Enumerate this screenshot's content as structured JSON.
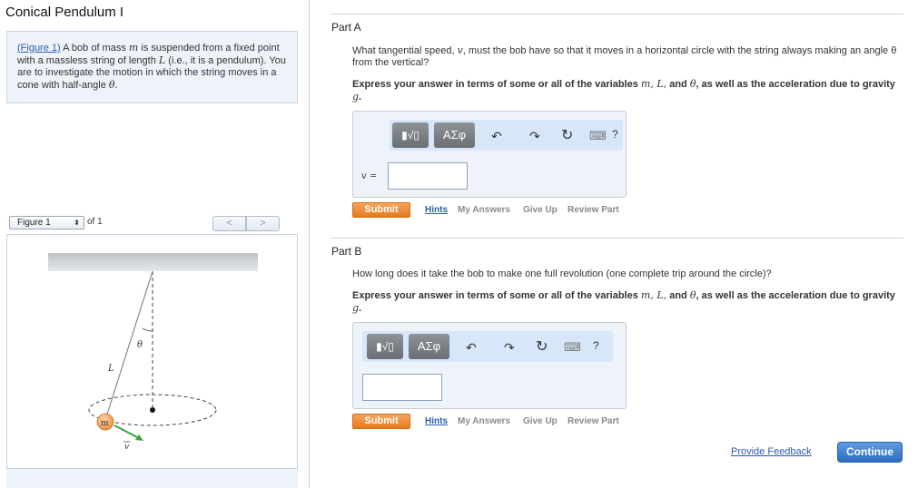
{
  "page": {
    "title": "Conical Pendulum I"
  },
  "intro": {
    "figure_link": "(Figure 1)",
    "text_a": " A bob of mass ",
    "mass_var": "m",
    "text_b": " is suspended from a fixed point with a massless string of length ",
    "length_var": "L",
    "text_c": " (i.e., it is a pendulum). You are to investigate the motion in which the string moves in a cone with half-angle ",
    "angle_var": "θ",
    "text_d": "."
  },
  "figure_nav": {
    "selected": "Figure 1",
    "arrows": "⬍",
    "of_text": "of 1",
    "prev": "<",
    "next": ">"
  },
  "figure": {
    "label_theta": "θ",
    "label_L": "L",
    "label_m": "m",
    "label_v": "v"
  },
  "toolbar": {
    "template_symbol": "▮√▯",
    "greek": "ΑΣφ",
    "undo": "↶",
    "redo": "↷",
    "reset": "↻",
    "keyboard": "⌨",
    "help": "?"
  },
  "part_a": {
    "label": "Part A",
    "question_pre": "What tangential speed, ",
    "question_var": "v",
    "question_post": ", must the bob have so that it moves in a horizontal circle with the string always making an angle θ from the vertical?",
    "instructions_pre": "Express your answer in terms of some or all of the variables ",
    "instructions_vars": "m, L,",
    "instructions_mid": " and ",
    "instructions_theta": "θ",
    "instructions_post": ", as well as the acceleration due to gravity ",
    "instructions_g": "g",
    "instructions_end": ".",
    "var_label": "v =",
    "input_value": "",
    "submit": "Submit",
    "hints": "Hints",
    "my_answers": "My Answers",
    "give_up": "Give Up",
    "review": "Review Part"
  },
  "part_b": {
    "label": "Part B",
    "question": "How long does it take the bob to make one full revolution (one complete trip around the circle)?",
    "instructions_pre": "Express your answer in terms of some or all of the variables ",
    "instructions_vars": "m, L,",
    "instructions_mid": " and ",
    "instructions_theta": "θ",
    "instructions_post": ", as well as the acceleration due to gravity ",
    "instructions_g": "g",
    "instructions_end": ".",
    "input_value": "",
    "submit": "Submit",
    "hints": "Hints",
    "my_answers": "My Answers",
    "give_up": "Give Up",
    "review": "Review Part"
  },
  "footer": {
    "feedback": "Provide Feedback",
    "continue": "Continue"
  },
  "colors": {
    "accent_blue": "#2a5db0",
    "submit_orange": "#e57c1d",
    "panel_bg": "#eef3f9",
    "toolbar_bg": "#d7e7f9",
    "bob_orange": "#f0a15a",
    "velocity_green": "#3aa53a"
  }
}
